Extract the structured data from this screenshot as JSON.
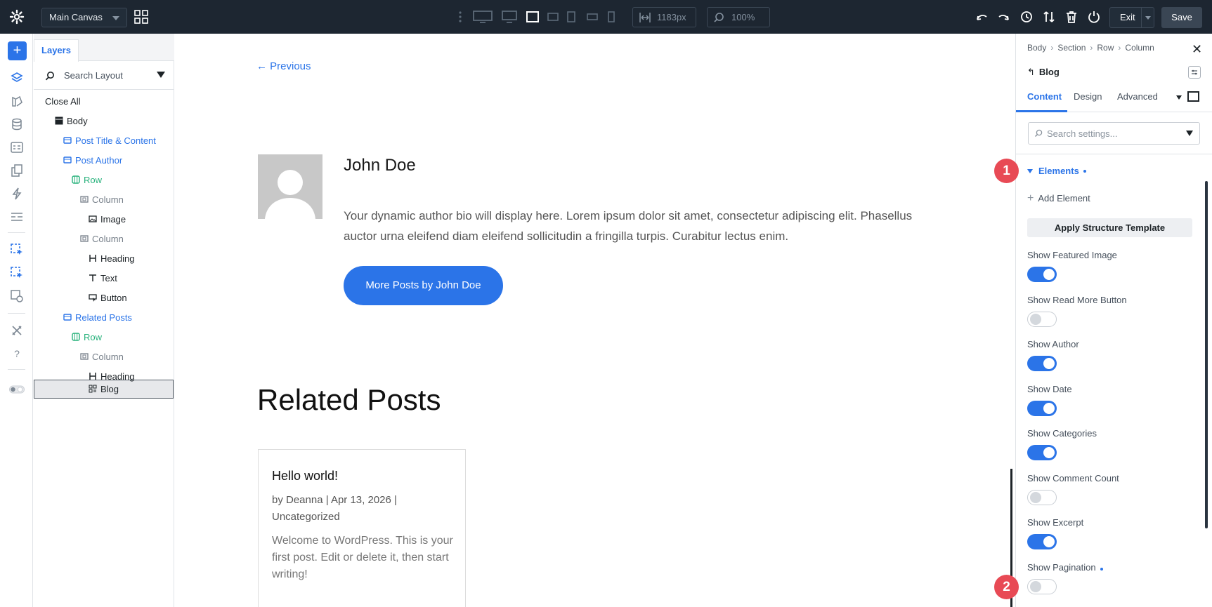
{
  "topbar": {
    "canvas_select": "Main Canvas",
    "width_value": "1183px",
    "zoom_value": "100%",
    "exit_label": "Exit",
    "save_label": "Save"
  },
  "layers": {
    "tab_label": "Layers",
    "search_placeholder": "Search Layout",
    "close_all": "Close All",
    "tree": [
      {
        "label": "Body",
        "icon": "section-icon"
      },
      {
        "label": "Post Title & Content",
        "icon": "section-icon"
      },
      {
        "label": "Post Author",
        "icon": "section-icon"
      },
      {
        "label": "Row",
        "icon": "row-icon"
      },
      {
        "label": "Column",
        "icon": "column-icon"
      },
      {
        "label": "Image",
        "icon": "image-icon"
      },
      {
        "label": "Column",
        "icon": "column-icon"
      },
      {
        "label": "Heading",
        "icon": "heading-icon"
      },
      {
        "label": "Text",
        "icon": "text-icon"
      },
      {
        "label": "Button",
        "icon": "button-icon"
      },
      {
        "label": "Related Posts",
        "icon": "section-icon"
      },
      {
        "label": "Row",
        "icon": "row-icon"
      },
      {
        "label": "Column",
        "icon": "column-icon"
      },
      {
        "label": "Heading",
        "icon": "heading-icon"
      },
      {
        "label": "Blog",
        "icon": "blog-icon"
      }
    ]
  },
  "canvas": {
    "prev_link": "← Previous",
    "author_name": "John Doe",
    "author_bio": "Your dynamic author bio will display here. Lorem ipsum dolor sit amet, consectetur adipiscing elit. Phasellus auctor urna eleifend diam eleifend sollicitudin a fringilla turpis. Curabitur lectus enim.",
    "more_button": "More Posts by John Doe",
    "related_title": "Related Posts",
    "post": {
      "title": "Hello world!",
      "meta": "by Deanna | Apr 13, 2026 | Uncategorized",
      "excerpt": "Welcome to WordPress. This is your first post. Edit or delete it, then start writing!"
    }
  },
  "settings": {
    "breadcrumb": [
      "Body",
      "Section",
      "Row",
      "Column"
    ],
    "module_name": "Blog",
    "tabs": [
      "Content",
      "Design",
      "Advanced"
    ],
    "search_placeholder": "Search settings...",
    "group_title": "Elements",
    "add_element": "Add Element",
    "apply_template": "Apply Structure Template",
    "toggles": [
      {
        "label": "Show Featured Image",
        "on": true
      },
      {
        "label": "Show Read More Button",
        "on": false
      },
      {
        "label": "Show Author",
        "on": true
      },
      {
        "label": "Show Date",
        "on": true
      },
      {
        "label": "Show Categories",
        "on": true
      },
      {
        "label": "Show Comment Count",
        "on": false
      },
      {
        "label": "Show Excerpt",
        "on": true
      },
      {
        "label": "Show Pagination",
        "on": false
      }
    ]
  },
  "badges": [
    "1",
    "2"
  ],
  "colors": {
    "topbar_bg": "#1d2631",
    "accent_blue": "#2b74e8",
    "row_green": "#28b27c",
    "badge_red": "#e84a55"
  }
}
